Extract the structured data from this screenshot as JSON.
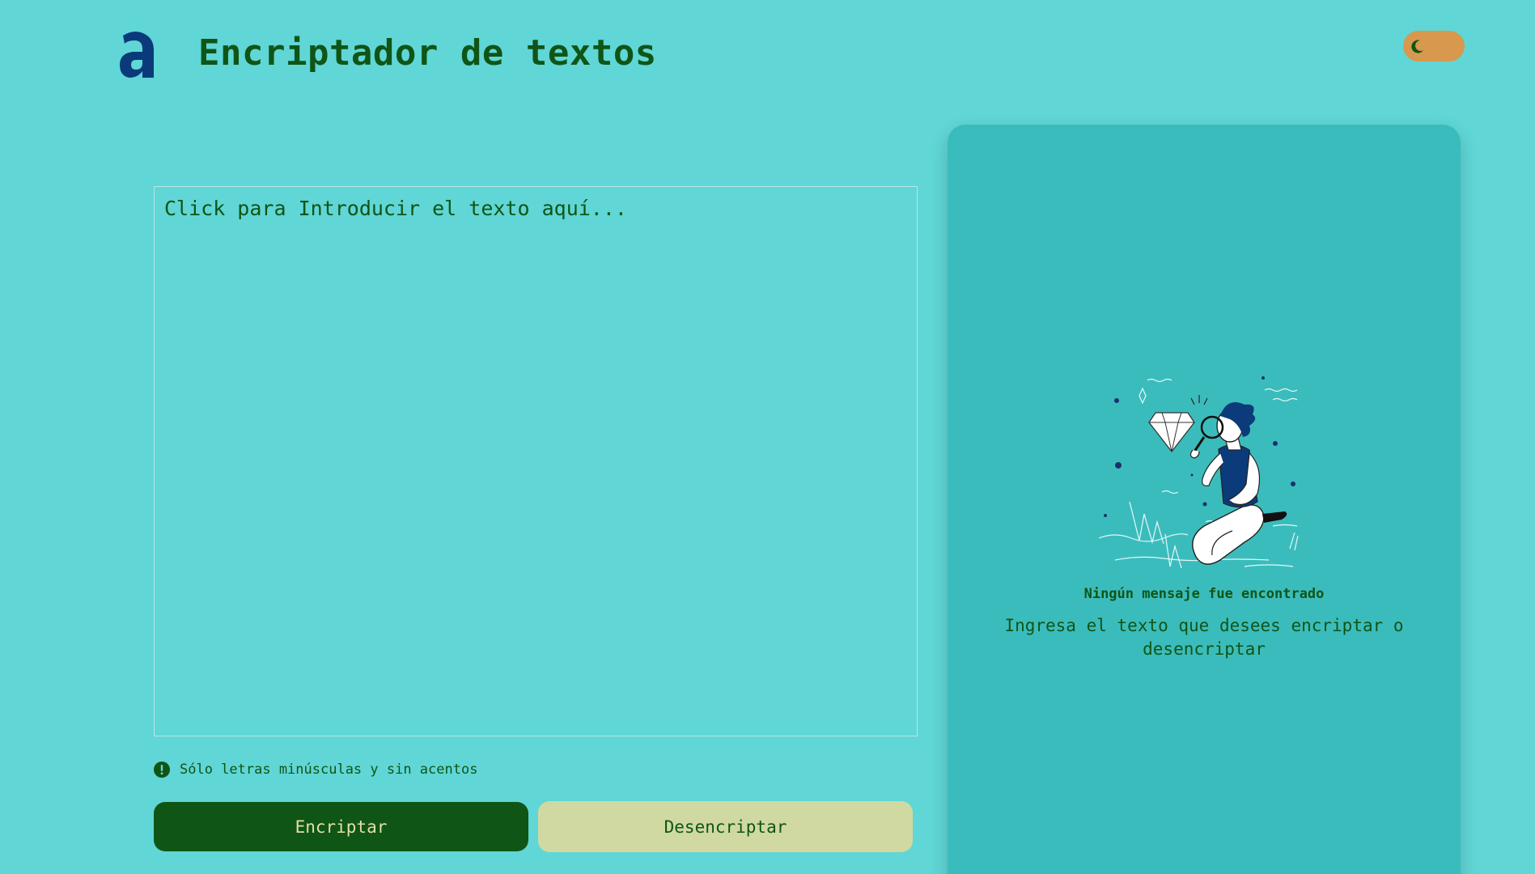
{
  "header": {
    "title": "Encriptador de textos",
    "logo_icon": "alura-a-logo-icon",
    "theme_toggle_icon": "moon-icon"
  },
  "input": {
    "placeholder": "Click para Introducir el texto aquí...",
    "value": ""
  },
  "hint": {
    "icon": "exclamation-circle-icon",
    "text": "Sólo letras minúsculas y sin acentos"
  },
  "buttons": {
    "encrypt_label": "Encriptar",
    "decrypt_label": "Desencriptar"
  },
  "output": {
    "illustration": "person-with-magnifying-glass-illustration",
    "empty_title": "Ningún mensaje fue encontrado",
    "empty_description": "Ingresa el texto que desees encriptar o desencriptar"
  },
  "colors": {
    "background": "#60d6d6",
    "panel": "#3bbcbc",
    "primary_dark_green": "#0f5516",
    "secondary_button": "#d0d9a1",
    "toggle": "#d8984e",
    "logo_blue": "#0a3a7a"
  }
}
